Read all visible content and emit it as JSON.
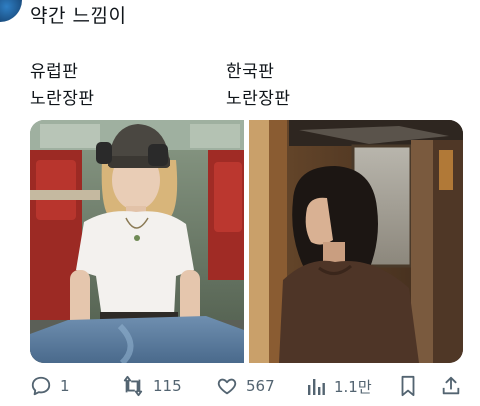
{
  "post": {
    "text": "약간 느낌이"
  },
  "captions": {
    "left": {
      "line1": "유럽판",
      "line2": "노란장판"
    },
    "right": {
      "line1": "한국판",
      "line2": "노란장판"
    }
  },
  "actions": {
    "reply": {
      "icon": "reply-icon",
      "count": "1"
    },
    "retweet": {
      "icon": "retweet-icon",
      "count": "115"
    },
    "like": {
      "icon": "heart-icon",
      "count": "567"
    },
    "views": {
      "icon": "views-icon",
      "count": "1.1만"
    },
    "bookmark": {
      "icon": "bookmark-icon"
    },
    "share": {
      "icon": "share-icon"
    }
  },
  "colors": {
    "text": "#0f1419",
    "muted": "#536471",
    "background": "#ffffff"
  }
}
